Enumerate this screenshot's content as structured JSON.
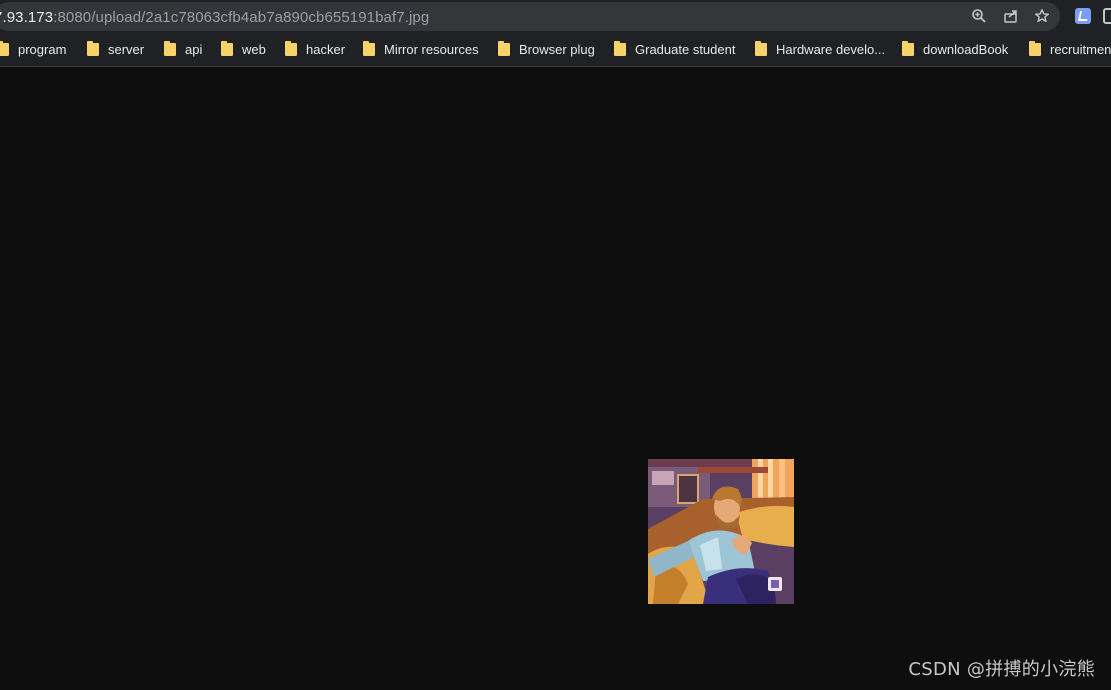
{
  "browser": {
    "address_host": "7.93.173",
    "address_path": ":8080/upload/2a1c78063cfb4ab7a890cb655191baf7.jpg",
    "icons": [
      "zoom-icon",
      "share-icon",
      "bookmark-star-icon",
      "extension-icon",
      "extension-icon"
    ]
  },
  "bookmarks": [
    {
      "label": "program"
    },
    {
      "label": "server"
    },
    {
      "label": "api"
    },
    {
      "label": "web"
    },
    {
      "label": "hacker"
    },
    {
      "label": "Mirror resources"
    },
    {
      "label": "Browser plug"
    },
    {
      "label": "Graduate student"
    },
    {
      "label": "Hardware develo..."
    },
    {
      "label": "downloadBook"
    },
    {
      "label": "recruitmen"
    }
  ],
  "watermark": "CSDN @拼搏的小浣熊",
  "colors": {
    "page_background": "#0e0e0e",
    "toolbar": "#202124",
    "folder": "#f6d36a"
  }
}
